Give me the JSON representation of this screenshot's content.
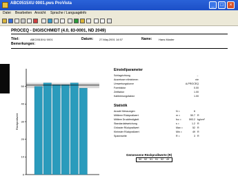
{
  "window": {
    "title": "ABC0515XU 0001.pws  ProVista"
  },
  "menu": [
    "Datei",
    "Bearbeiten",
    "Ansicht",
    "Sprache / Language",
    "Info"
  ],
  "report": {
    "heading": "PROCEQ - DIGISCHMIDT (4.0, 83-0001, ND 2049)",
    "title_label": "Titel:",
    "title_value": "ABC0515XU 0001",
    "date_label": "Datum:",
    "date_value": "27.May.2001 14:57",
    "name_label": "Name:",
    "name_value": "Hans Muster",
    "remarks_label": "Bemerkungen:"
  },
  "params": {
    "title": "Einstellparameter",
    "rows": [
      {
        "label": "Schlagrichtung",
        "value": "→"
      },
      {
        "label": "Ausreisser eliminieren",
        "value": "nie"
      },
      {
        "label": "Umwertungskurve",
        "value": "A-PROCEQ"
      },
      {
        "label": "Formfaktor",
        "value": "0.00"
      },
      {
        "label": "Zeitfaktor",
        "value": "1.00"
      },
      {
        "label": "Kalibrierungsfaktor",
        "value": "1.00"
      }
    ]
  },
  "stats": {
    "title": "Statistik",
    "rows": [
      {
        "label": "Anzahl Messungen",
        "sym": "N =",
        "value": "6",
        "unit": ""
      },
      {
        "label": "Mittlerer Rückprallwert",
        "sym": "m =",
        "value": "50.7",
        "unit": "R"
      },
      {
        "label": "Mittlere Druckfestigkeit",
        "sym": "fcc =",
        "value": "593.2",
        "unit": "kg/cm²"
      },
      {
        "label": "Standardabweichung",
        "sym": "s =",
        "value": "1.2",
        "unit": "R"
      },
      {
        "label": "Grösster Rückprallwert",
        "sym": "Max =",
        "value": "52",
        "unit": "R"
      },
      {
        "label": "Kleinster Rückprallwert",
        "sym": "Min =",
        "value": "49",
        "unit": "R"
      },
      {
        "label": "Spannweite",
        "sym": "R =",
        "value": "3",
        "unit": "R"
      }
    ]
  },
  "table": {
    "title": "Gemessene Rückprallwerte (R)",
    "values": [
      "50",
      "52",
      "51",
      "51",
      "52",
      "49"
    ]
  },
  "chart_data": {
    "type": "bar",
    "ylabel": "Rückprallwert",
    "ylim": [
      0,
      60
    ],
    "yticks": [
      0,
      10,
      20,
      30,
      40,
      50
    ],
    "values": [
      50,
      52,
      51,
      51,
      52,
      49
    ],
    "mean": 50.7,
    "band": [
      49,
      52
    ],
    "bar_color": "#2a9bbc"
  }
}
